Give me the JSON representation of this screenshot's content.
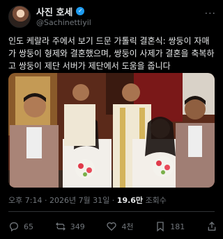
{
  "author": {
    "display_name": "사진 호세",
    "handle": "@Sachinettiyil",
    "verified": true
  },
  "tweet": {
    "text": "인도 케랄라 주에서 보기 드문 가톨릭 결혼식: 쌍둥이 자매가 쌍둥이 형제와 결혼했으며, 쌍둥이 사제가 결혼을 축복하고 쌍둥이 제단 서버가 제단에서 도움을 줍니다",
    "time": "오후 7:14",
    "date": "2026년 7월 31일",
    "views_count": "19.6만",
    "views_label": "조회수"
  },
  "actions": {
    "replies": "65",
    "reposts": "349",
    "likes": "4천",
    "bookmarks": "181"
  },
  "colors": {
    "background": "#000000",
    "text": "#e7e9ea",
    "muted": "#71767b",
    "verified": "#1d9bf0"
  },
  "icons": [
    "more-icon",
    "verified-badge-icon",
    "reply-icon",
    "repost-icon",
    "like-icon",
    "bookmark-icon",
    "share-icon"
  ]
}
